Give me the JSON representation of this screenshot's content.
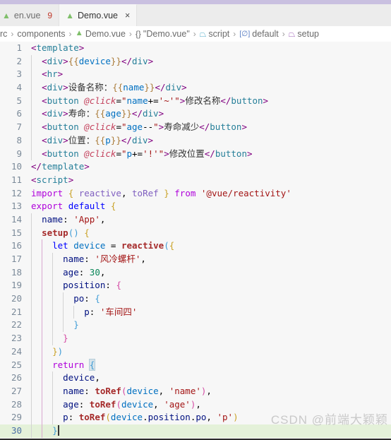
{
  "window": {
    "accent_color": "#c9c0e0",
    "editor_background": "#f7f7f7",
    "tabbar_background": "#ececec"
  },
  "tabs": [
    {
      "label": "en.vue",
      "icon": "vue-icon",
      "badge": "9",
      "active": false,
      "truncated": true
    },
    {
      "label": "Demo.vue",
      "icon": "vue-icon",
      "close": "×",
      "active": true
    }
  ],
  "breadcrumb": {
    "separator": "›",
    "items": [
      {
        "label": "rc",
        "icon": null
      },
      {
        "label": "components",
        "icon": null
      },
      {
        "label": "Demo.vue",
        "icon": "vue-icon"
      },
      {
        "label": "\"Demo.vue\"",
        "icon": "braces-icon"
      },
      {
        "label": "script",
        "icon": "cube-icon"
      },
      {
        "label": "default",
        "icon": "module-icon"
      },
      {
        "label": "setup",
        "icon": "cube-icon"
      }
    ]
  },
  "editor": {
    "language": "vue",
    "cursor_line": 30,
    "watermark": "CSDN @前端大颖颖",
    "lines": [
      {
        "n": 1,
        "text": "<template>"
      },
      {
        "n": 2,
        "text": "  <div>{{device}}</div>"
      },
      {
        "n": 3,
        "text": "  <hr>"
      },
      {
        "n": 4,
        "text": "  <div>设备名称：{{name}}</div>"
      },
      {
        "n": 5,
        "text": "  <button @click=\"name+='~'\">修改名称</button>"
      },
      {
        "n": 6,
        "text": "  <div>寿命：{{age}}</div>"
      },
      {
        "n": 7,
        "text": "  <button @click=\"age--\">寿命减少</button>"
      },
      {
        "n": 8,
        "text": "  <div>位置：{{p}}</div>"
      },
      {
        "n": 9,
        "text": "  <button @click=\"p+='!'\">修改位置</button>"
      },
      {
        "n": 10,
        "text": "</template>"
      },
      {
        "n": 11,
        "text": "<script>"
      },
      {
        "n": 12,
        "text": "import { reactive, toRef } from '@vue/reactivity'"
      },
      {
        "n": 13,
        "text": "export default {"
      },
      {
        "n": 14,
        "text": "  name: 'App',"
      },
      {
        "n": 15,
        "text": "  setup() {"
      },
      {
        "n": 16,
        "text": "    let device = reactive({"
      },
      {
        "n": 17,
        "text": "      name: '风冷螺杆',"
      },
      {
        "n": 18,
        "text": "      age: 30,"
      },
      {
        "n": 19,
        "text": "      position: {"
      },
      {
        "n": 20,
        "text": "        po: {"
      },
      {
        "n": 21,
        "text": "          p: '车间四'"
      },
      {
        "n": 22,
        "text": "        }"
      },
      {
        "n": 23,
        "text": "      }"
      },
      {
        "n": 24,
        "text": "    })"
      },
      {
        "n": 25,
        "text": "    return {"
      },
      {
        "n": 26,
        "text": "      device,"
      },
      {
        "n": 27,
        "text": "      name: toRef(device, 'name'),"
      },
      {
        "n": 28,
        "text": "      age: toRef(device, 'age'),"
      },
      {
        "n": 29,
        "text": "      p: toRef(device.position.po, 'p')"
      },
      {
        "n": 30,
        "text": "    }"
      }
    ]
  }
}
